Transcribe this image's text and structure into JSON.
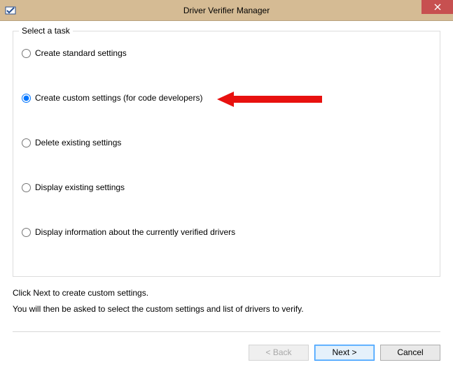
{
  "window": {
    "title": "Driver Verifier Manager"
  },
  "groupbox": {
    "legend": "Select a task",
    "options": {
      "standard": "Create standard settings",
      "custom": "Create custom settings (for code developers)",
      "delete": "Delete existing settings",
      "display": "Display existing settings",
      "info": "Display information about the currently verified drivers"
    },
    "selected": "custom"
  },
  "help": {
    "line1": "Click Next to create custom settings.",
    "line2": "You will then be asked to select the custom settings and list of drivers to verify."
  },
  "buttons": {
    "back": "< Back",
    "next": "Next >",
    "cancel": "Cancel"
  }
}
